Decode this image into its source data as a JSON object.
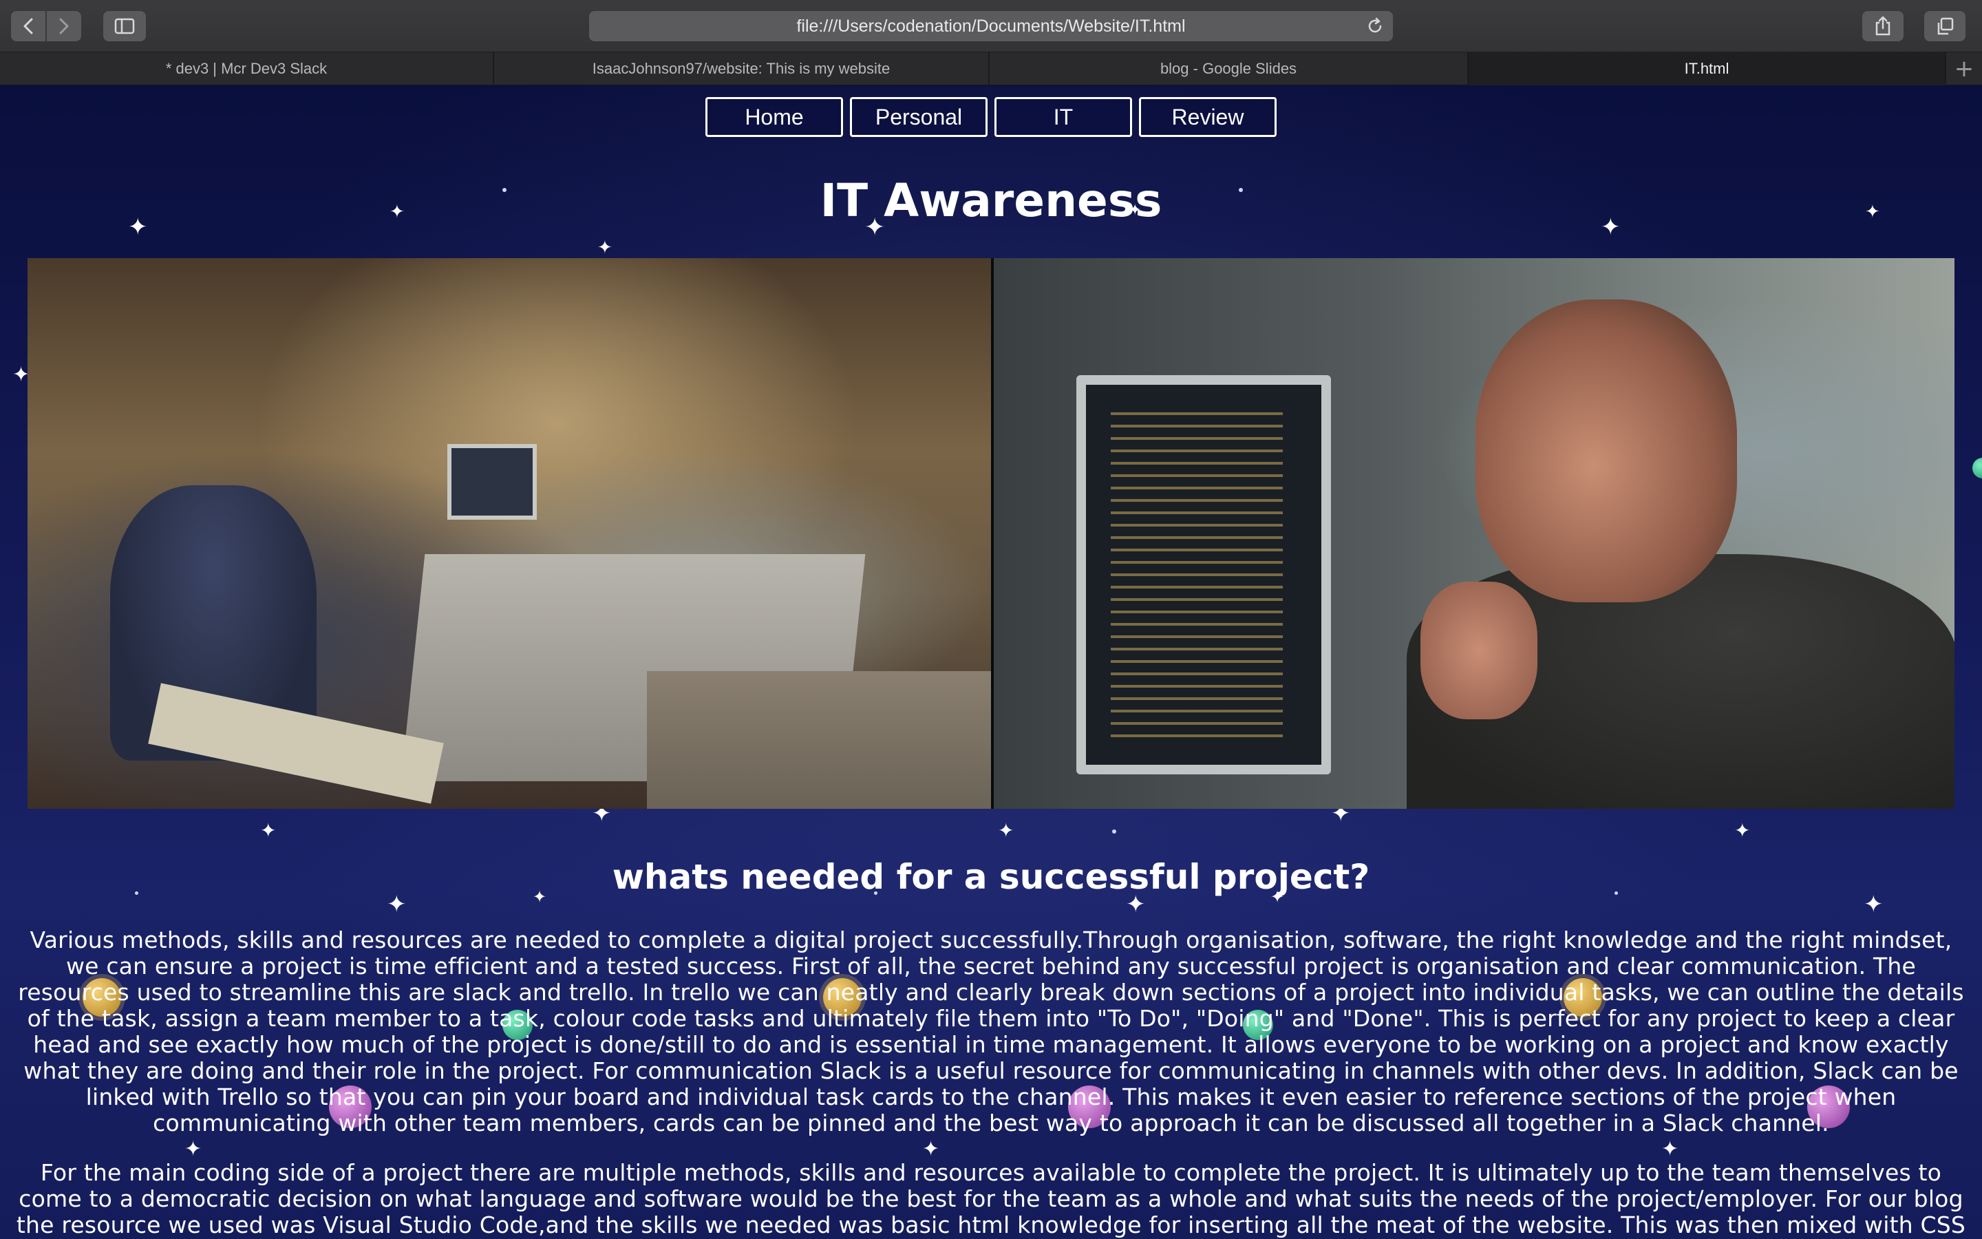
{
  "browser": {
    "url": "file:///Users/codenation/Documents/Website/IT.html",
    "tabs": [
      {
        "label": "* dev3 | Mcr Dev3 Slack",
        "active": false
      },
      {
        "label": "IsaacJohnson97/website: This is my website",
        "active": false
      },
      {
        "label": "blog - Google Slides",
        "active": false
      },
      {
        "label": "IT.html",
        "active": true
      }
    ],
    "icons": [
      "back-icon",
      "forward-icon",
      "sidebar-icon",
      "reload-icon",
      "share-icon",
      "tabs-overview-icon",
      "new-tab-icon"
    ]
  },
  "nav": {
    "links": [
      "Home",
      "Personal",
      "IT",
      "Review"
    ]
  },
  "page": {
    "title": "IT Awareness",
    "section_title": "whats needed for a successful project?",
    "paragraph1": "Various methods, skills and resources are needed to complete a digital project successfully.Through organisation, software, the right knowledge and the right mindset, we can ensure a project is time efficient and a tested success. First of all, the secret behind any successful project is organisation and clear communication. The resources used to streamline this are slack and trello. In trello we can neatly and clearly break down sections of a project into individual tasks, we can outline the details of the task, assign a team member to a task, colour code tasks and ultimately file them into \"To Do\", \"Doing\" and \"Done\". This is perfect for any project to keep a clear head and see exactly how much of the project is done/still to do and is essential in time management. It allows everyone to be working on a project and know exactly what they are doing and their role in the project. For communication Slack is a useful resource for communicating in channels with other devs. In addition, Slack can be linked with Trello so that you can pin your board and individual task cards to the channel. This makes it even easier to reference sections of the project when communicating with other team members, cards can be pinned and the best way to approach it can be discussed all together in a Slack channel.",
    "paragraph2": "For the main coding side of a project there are multiple methods, skills and resources available to complete the project. It is ultimately up to the team themselves to come to a democratic decision on what language and software would be the best for the team as a whole and what suits the needs of the project/employer. For our blog the resource we used was Visual Studio Code,and the skills we needed was basic html knowledge for inserting all the meat of the website. This was then mixed with CSS to format the blog and"
  },
  "colors": {
    "background": "#141a58",
    "text": "#ffffff",
    "toolbar": "#3b3b3d"
  }
}
